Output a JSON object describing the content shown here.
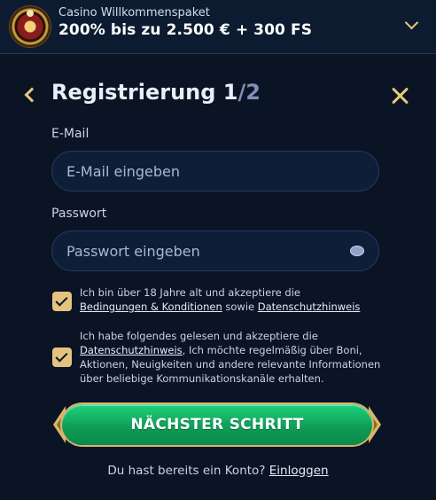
{
  "promo": {
    "subtitle": "Casino Willkommenspaket",
    "title": "200% bis zu 2.500 € + 300 FS",
    "logo_icon": "roulette-wheel-icon",
    "toggle_icon": "chevron-down-icon"
  },
  "header": {
    "title_main": "Registrierung 1",
    "title_sep": "/",
    "title_total": "2",
    "back_icon": "chevron-left-icon",
    "close_icon": "close-icon"
  },
  "form": {
    "email_label": "E-Mail",
    "email_placeholder": "E-Mail eingeben",
    "password_label": "Passwort",
    "password_placeholder": "Passwort eingeben",
    "password_toggle_icon": "eye-icon"
  },
  "consents": [
    {
      "checked": true,
      "text_before": "Ich bin über 18 Jahre alt und akzeptiere die",
      "link1": "Bedingungen & Konditionen",
      "text_mid": " sowie ",
      "link2": "Datenschutzhinweis"
    },
    {
      "checked": true,
      "text_before": "Ich habe folgendes gelesen und akzeptiere die",
      "link1": "Datenschutzhinweis",
      "text_after": ", Ich möchte regelmäßig über Boni, Aktionen, Neuigkeiten und andere relevante Informationen über beliebige Kommunikationskanäle erhalten."
    }
  ],
  "actions": {
    "next_label": "NÄCHSTER SCHRITT",
    "have_account": "Du hast bereits ein Konto? ",
    "login_link": "Einloggen"
  },
  "colors": {
    "background": "#0a1424",
    "accent_gold": "#e4c380",
    "button_green": "#12b463",
    "input_bg": "#0f1e37"
  }
}
